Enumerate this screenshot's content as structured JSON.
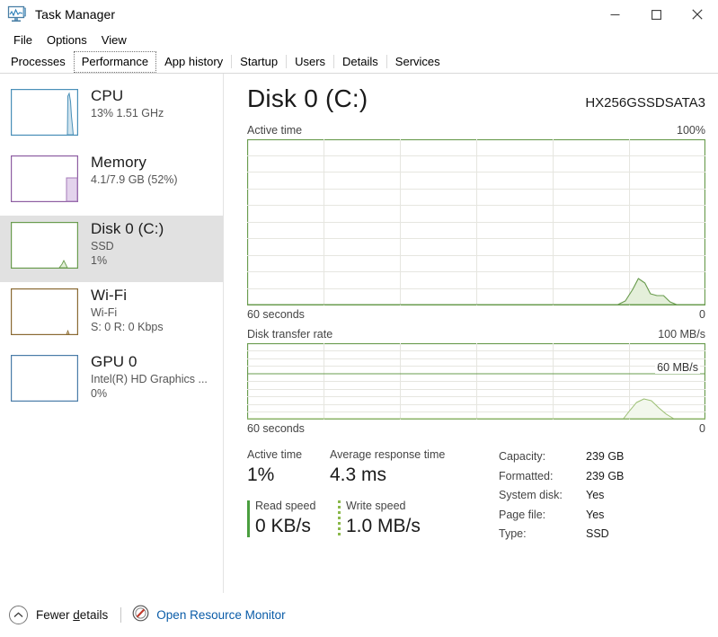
{
  "window": {
    "title": "Task Manager",
    "icon": "task-manager-icon",
    "minimize": "─",
    "maximize": "☐",
    "close": "✕"
  },
  "menu": {
    "items": [
      "File",
      "Options",
      "View"
    ]
  },
  "tabs": {
    "items": [
      "Processes",
      "Performance",
      "App history",
      "Startup",
      "Users",
      "Details",
      "Services"
    ],
    "active": "Performance"
  },
  "sidebar": {
    "items": [
      {
        "name": "CPU",
        "line1": "13%  1.51 GHz",
        "line2": "",
        "color": "#4a90b8",
        "selected": false,
        "graph": "cpu-spike"
      },
      {
        "name": "Memory",
        "line1": "4.1/7.9 GB (52%)",
        "line2": "",
        "color": "#8e5ea2",
        "selected": false,
        "graph": "memory-block"
      },
      {
        "name": "Disk 0 (C:)",
        "line1": "SSD",
        "line2": "1%",
        "color": "#6a9c4f",
        "selected": true,
        "graph": "disk-bump"
      },
      {
        "name": "Wi-Fi",
        "line1": "Wi-Fi",
        "line2": "S: 0 R: 0 Kbps",
        "color": "#8a6a33",
        "selected": false,
        "graph": "wifi-flat"
      },
      {
        "name": "GPU 0",
        "line1": "Intel(R) HD Graphics ...",
        "line2": "0%",
        "color": "#4a7ca8",
        "selected": false,
        "graph": "gpu-flat"
      }
    ]
  },
  "main": {
    "title": "Disk 0 (C:)",
    "model": "HX256GSSDSATA3",
    "graph_active": {
      "label": "Active time",
      "max_label": "100%",
      "left_foot": "60 seconds",
      "right_foot": "0"
    },
    "graph_transfer": {
      "label": "Disk transfer rate",
      "max_label": "100 MB/s",
      "scale_label": "60 MB/s",
      "left_foot": "60 seconds",
      "right_foot": "0"
    },
    "stats": {
      "active_time_label": "Active time",
      "active_time_value": "1%",
      "response_label": "Average response time",
      "response_value": "4.3 ms",
      "read_label": "Read speed",
      "read_value": "0 KB/s",
      "write_label": "Write speed",
      "write_value": "1.0 MB/s"
    },
    "details": [
      {
        "key": "Capacity:",
        "value": "239 GB"
      },
      {
        "key": "Formatted:",
        "value": "239 GB"
      },
      {
        "key": "System disk:",
        "value": "Yes"
      },
      {
        "key": "Page file:",
        "value": "Yes"
      },
      {
        "key": "Type:",
        "value": "SSD"
      }
    ]
  },
  "footer": {
    "fewer_pre": "Fewer ",
    "fewer_underline": "d",
    "fewer_post": "etails",
    "resource_monitor": "Open Resource Monitor"
  },
  "chart_data": [
    {
      "type": "area",
      "title": "Active time",
      "ylabel": "",
      "xlabel": "60 seconds",
      "ylim": [
        0,
        100
      ],
      "unit": "%",
      "grid": true,
      "grid_rows": 10,
      "grid_cols": 6,
      "current_value": 1,
      "x": [
        0,
        40,
        44,
        48,
        52,
        56,
        60,
        64,
        68,
        72,
        76,
        80,
        84,
        88,
        92,
        96,
        100
      ],
      "y": [
        0,
        0,
        0,
        0,
        0,
        0,
        0,
        2,
        9,
        16,
        13,
        7,
        6,
        6,
        2,
        0,
        0
      ]
    },
    {
      "type": "area",
      "title": "Disk transfer rate",
      "ylabel": "",
      "xlabel": "60 seconds",
      "ylim": [
        0,
        100
      ],
      "unit": "MB/s",
      "grid": true,
      "grid_rows": 10,
      "grid_cols": 6,
      "scale_line": 60,
      "current_value": 1.0,
      "x": [
        0,
        40,
        48,
        56,
        60,
        64,
        68,
        72,
        76,
        80,
        84,
        88,
        92,
        96,
        100
      ],
      "y": [
        0,
        0,
        0,
        0,
        0,
        3,
        9,
        13,
        14,
        10,
        6,
        3,
        1,
        0,
        0
      ]
    }
  ]
}
